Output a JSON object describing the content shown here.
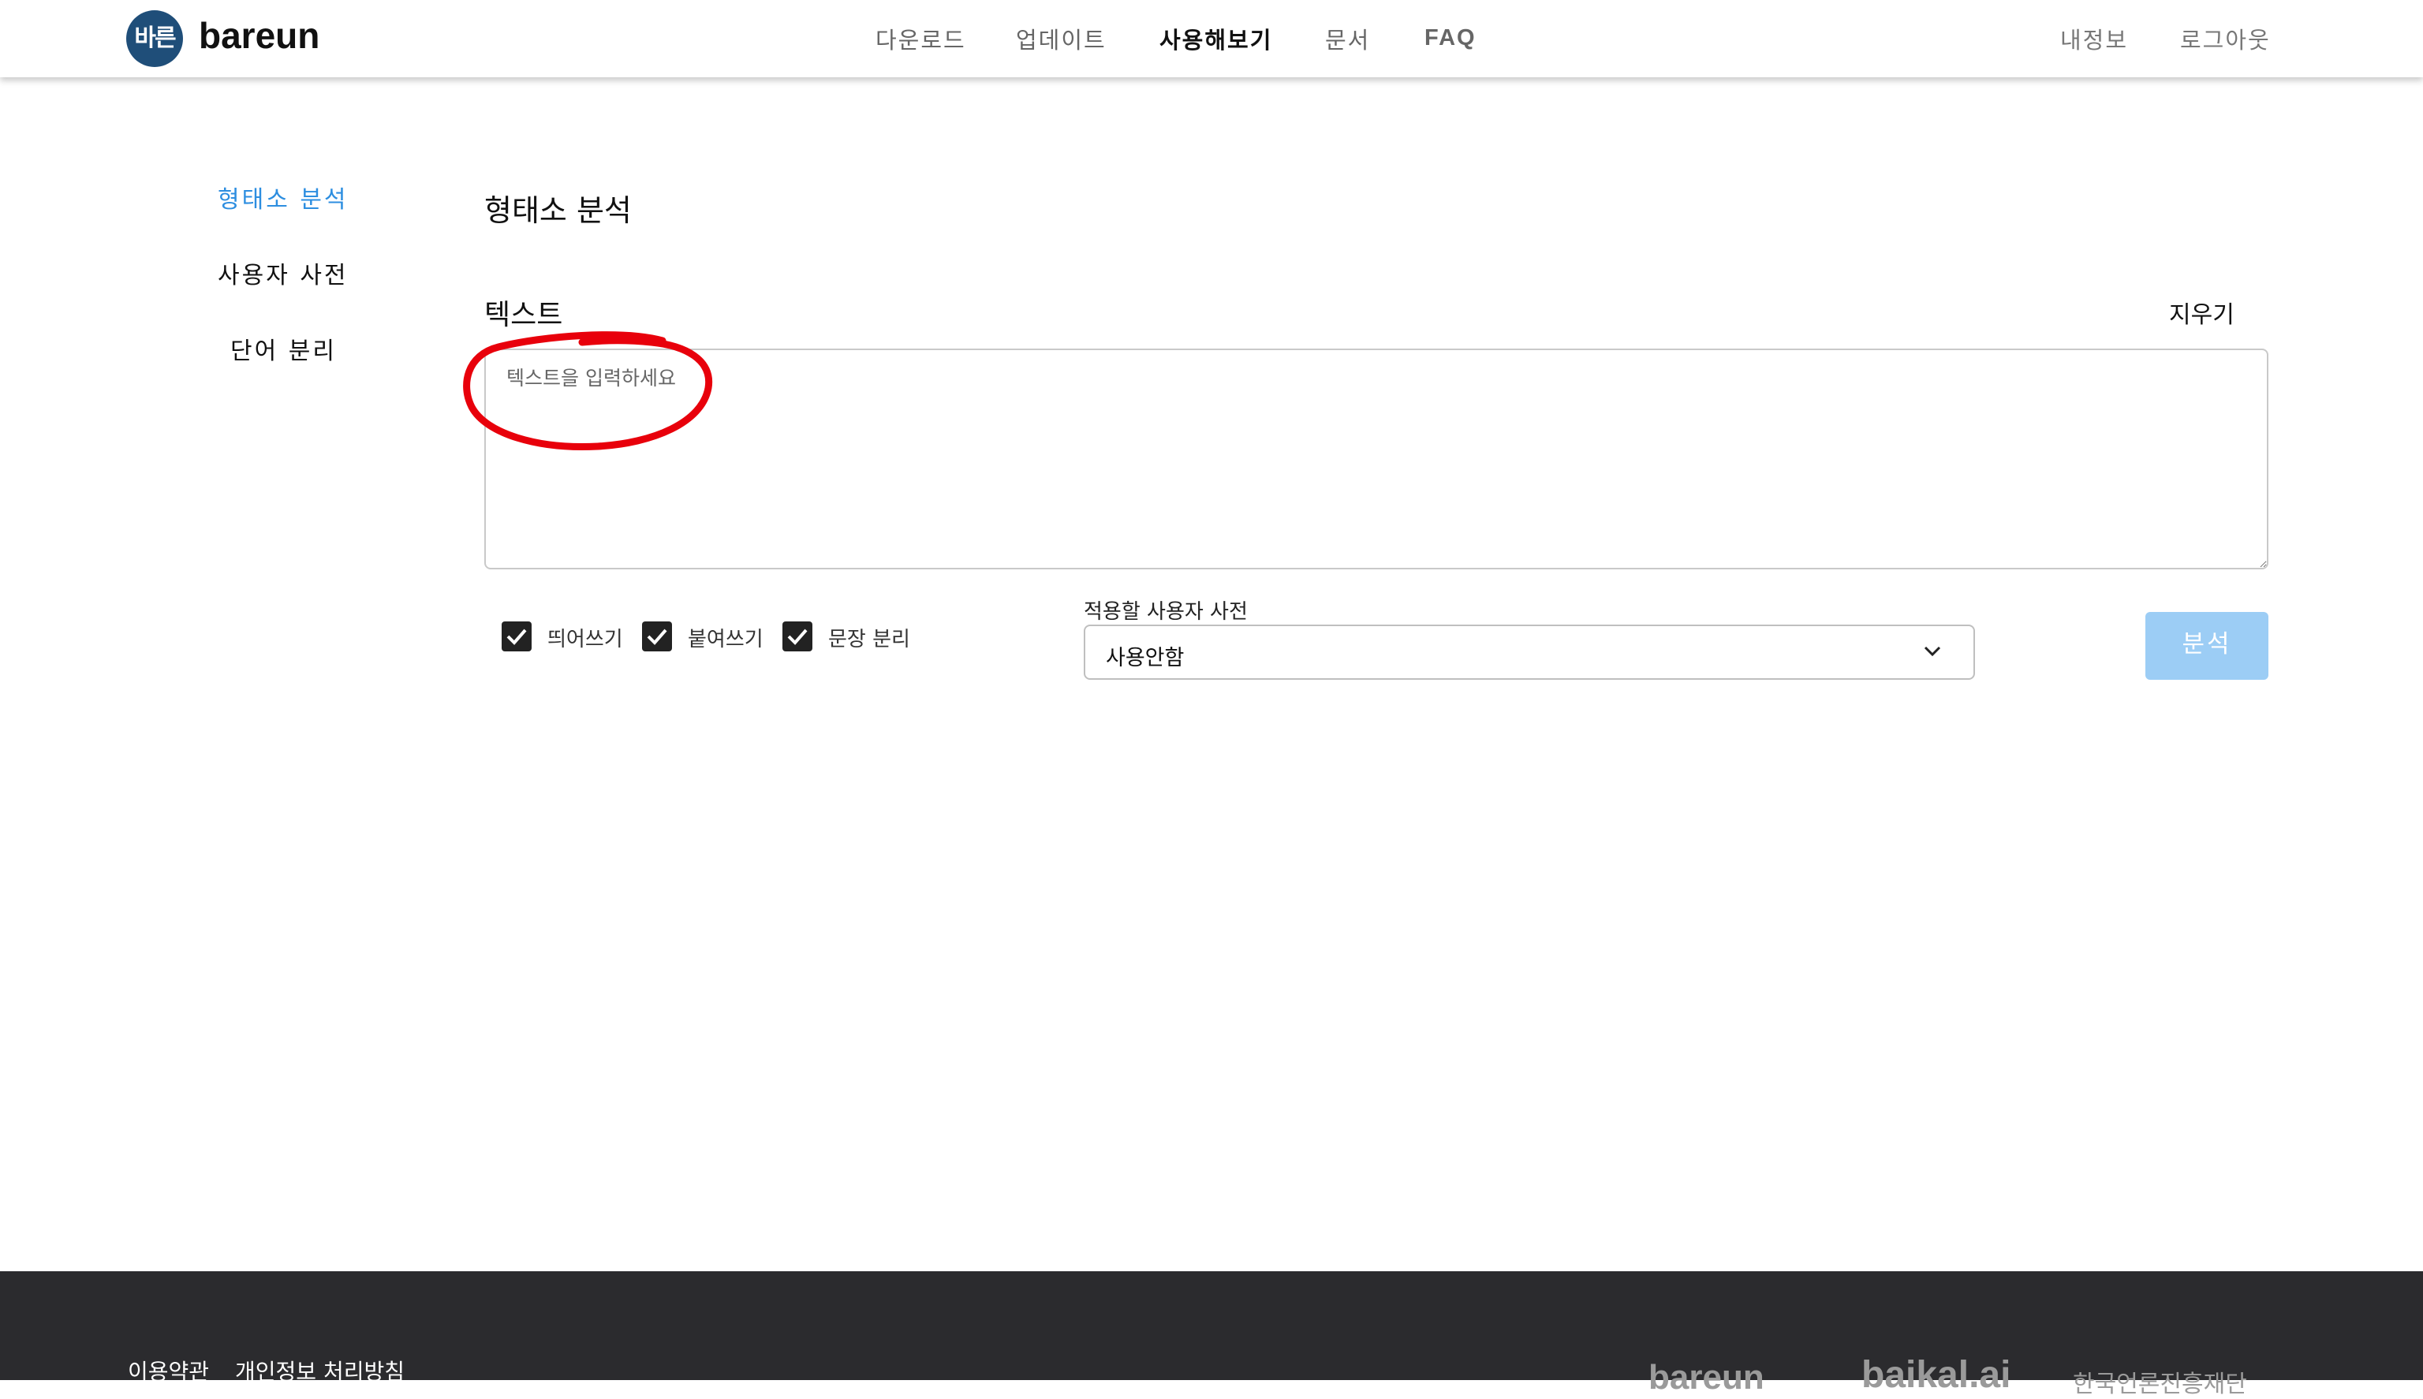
{
  "header": {
    "logo_mark": "바른",
    "logo_text": "bareun",
    "nav": [
      "다운로드",
      "업데이트",
      "사용해보기",
      "문서",
      "FAQ"
    ],
    "active_nav": "사용해보기",
    "account": "내정보",
    "logout": "로그아웃"
  },
  "sidebar": {
    "items": [
      {
        "label": "형태소 분석",
        "active": true
      },
      {
        "label": "사용자 사전",
        "active": false
      },
      {
        "label": "단어 분리",
        "active": false
      }
    ]
  },
  "main": {
    "title": "형태소 분석",
    "text_label": "텍스트",
    "clear_label": "지우기",
    "textarea_placeholder": "텍스트을 입력하세요",
    "textarea_value": "",
    "options": [
      {
        "label": "띄어쓰기",
        "checked": true
      },
      {
        "label": "붙여쓰기",
        "checked": true
      },
      {
        "label": "문장 분리",
        "checked": true
      }
    ],
    "dict_label": "적용할 사용자 사전",
    "dict_value": "사용안함",
    "analyze_label": "분석"
  },
  "footer": {
    "links": [
      "이용약관",
      "개인정보 처리방침"
    ],
    "partner_logos": [
      "bareun",
      "baikal.ai",
      "한국언론진흥재단"
    ]
  },
  "colors": {
    "accent": "#2d8ee0",
    "analyze_button": "#9ccdf5",
    "footer_bg": "#2b2b2e",
    "annotation": "#e8000b"
  },
  "icons": [
    "check-icon",
    "chevron-down-icon",
    "resize-handle-icon"
  ]
}
